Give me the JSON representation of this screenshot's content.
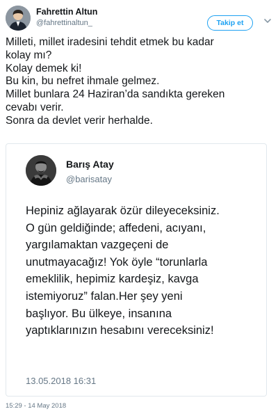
{
  "tweet": {
    "author": {
      "name": "Fahrettin Altun",
      "handle": "@fahrettinaltun_",
      "avatar_icon": "user-avatar"
    },
    "follow_button": "Takip et",
    "menu_icon": "chevron-down-icon",
    "text_lines": [
      "Milleti, millet iradesini tehdit etmek bu kadar",
      "kolay mı?",
      "Kolay demek ki!",
      "Bu kin, bu nefret ihmale gelmez.",
      "Millet bunlara 24 Haziran’da sandıkta gereken",
      "cevabı verir.",
      "Sonra da devlet verir herhalde."
    ],
    "timestamp": "15:29 - 14 May 2018",
    "colors": {
      "accent": "#1da1f2",
      "secondary_text": "#657786",
      "border": "#e1e8ed"
    }
  },
  "quoted": {
    "author": {
      "name": "Barış Atay",
      "handle": "@barisatay",
      "avatar_icon": "user-avatar"
    },
    "text_lines": [
      "Hepiniz ağlayarak özür dileyeceksiniz.",
      "O gün geldiğinde; affedeni, acıyanı,",
      "yargılamaktan vazgeçeni de",
      "unutmayacağız! Yok öyle “torunlarla",
      "emeklilik, hepimiz kardeşiz, kavga",
      "istemiyoruz” falan.Her şey yeni",
      "başlıyor. Bu ülkeye, insanına",
      "yaptıklarınızın hesabını vereceksiniz!"
    ],
    "date": "13.05.2018 16:31"
  }
}
